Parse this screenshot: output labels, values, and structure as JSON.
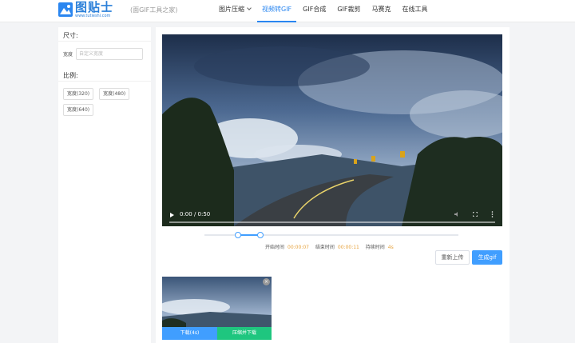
{
  "header": {
    "logo_title": "图贴士",
    "logo_url": "www.tutieshi.com",
    "slogan": "(面GIF工具之家)",
    "nav": [
      {
        "label": "图片压缩"
      },
      {
        "label": "视频转GIF"
      },
      {
        "label": "GIF合成"
      },
      {
        "label": "GIF裁剪"
      },
      {
        "label": "马赛克"
      },
      {
        "label": "在线工具"
      }
    ]
  },
  "left": {
    "size_title": "尺寸:",
    "width_label": "宽度",
    "width_placeholder": "自定义宽度",
    "ratio_title": "比例:",
    "ratio_buttons": [
      "宽度(320)",
      "宽度(480)",
      "宽度(640)"
    ]
  },
  "video": {
    "time": "0:00 / 0:50",
    "progress": 0
  },
  "trim": {
    "start_label": "开始时间",
    "start_value": "00:00:07",
    "end_label": "结束时间",
    "end_value": "00:00:11",
    "duration_label": "持续时间",
    "duration_value": "4s"
  },
  "actions": {
    "reupload": "重新上传",
    "generate": "生成gif"
  },
  "result": {
    "close": "×",
    "download": "下载(4s)",
    "compress": "压缩并下载"
  },
  "colors": {
    "accent": "#409eff",
    "green": "#1fc67f",
    "time_value": "#e6a23c"
  }
}
